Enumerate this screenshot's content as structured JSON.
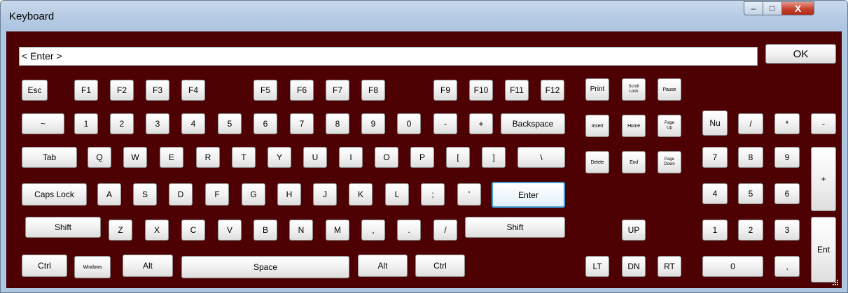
{
  "window": {
    "title": "Keyboard",
    "minimize_glyph": "–",
    "maximize_glyph": "□",
    "close_glyph": "X"
  },
  "display": {
    "value": "< Enter >"
  },
  "ok_label": "OK",
  "keys": {
    "esc": "Esc",
    "f1": "F1",
    "f2": "F2",
    "f3": "F3",
    "f4": "F4",
    "f5": "F5",
    "f6": "F6",
    "f7": "F7",
    "f8": "F8",
    "f9": "F9",
    "f10": "F10",
    "f11": "F11",
    "f12": "F12",
    "print": "Print",
    "scroll_lock": "Scroll Lock",
    "pause": "Pause",
    "tilde": "~",
    "d1": "1",
    "d2": "2",
    "d3": "3",
    "d4": "4",
    "d5": "5",
    "d6": "6",
    "d7": "7",
    "d8": "8",
    "d9": "9",
    "d0": "0",
    "minus": "-",
    "plus": "+",
    "backspace": "Backspace",
    "insert": "Insert",
    "home": "Home",
    "page_up": "Page Up",
    "tab": "Tab",
    "q": "Q",
    "w": "W",
    "e": "E",
    "r": "R",
    "t": "T",
    "y": "Y",
    "u": "U",
    "i": "I",
    "o": "O",
    "p": "P",
    "lbracket": "[",
    "rbracket": "]",
    "backslash": "\\",
    "delete": "Delete",
    "end": "End",
    "page_down": "Page Down",
    "caps_lock": "Caps Lock",
    "a": "A",
    "s": "S",
    "d": "D",
    "f": "F",
    "g": "G",
    "h": "H",
    "j": "J",
    "k": "K",
    "l": "L",
    "semicolon": ";",
    "quote": "'",
    "enter": "Enter",
    "shift": "Shift",
    "z": "Z",
    "x": "X",
    "c": "C",
    "v": "V",
    "b": "B",
    "n": "N",
    "m": "M",
    "comma": ",",
    "period": ".",
    "slash": "/",
    "ctrl": "Ctrl",
    "windows": "Windows",
    "alt": "Alt",
    "space": "Space",
    "up": "UP",
    "left": "LT",
    "down": "DN",
    "right": "RT",
    "num_lock": "Nu",
    "num_div": "/",
    "num_mul": "*",
    "num_sub": "-",
    "num_7": "7",
    "num_8": "8",
    "num_9": "9",
    "num_add": "+",
    "num_4": "4",
    "num_5": "5",
    "num_6": "6",
    "num_1": "1",
    "num_2": "2",
    "num_3": "3",
    "num_enter": "Ent",
    "num_0": "0",
    "num_dot": ","
  }
}
